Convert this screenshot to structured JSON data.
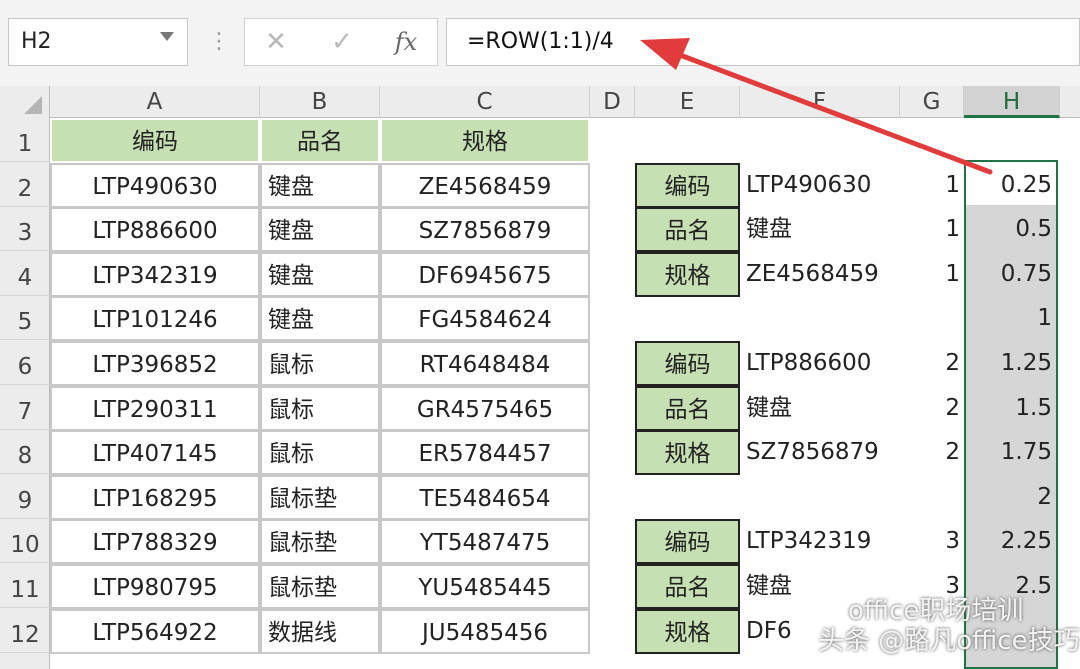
{
  "formula_bar": {
    "name_box": "H2",
    "cancel_icon": "✕",
    "enter_icon": "✓",
    "fx_label": "fx",
    "formula": "=ROW(1:1)/4"
  },
  "columns": [
    "A",
    "B",
    "C",
    "D",
    "E",
    "F",
    "G",
    "H"
  ],
  "selected_column": "H",
  "rows": [
    "1",
    "2",
    "3",
    "4",
    "5",
    "6",
    "7",
    "8",
    "9",
    "10",
    "11",
    "12"
  ],
  "table_headers": [
    "编码",
    "品名",
    "规格"
  ],
  "table_rows": [
    [
      "LTP490630",
      "键盘",
      "ZE4568459"
    ],
    [
      "LTP886600",
      "键盘",
      "SZ7856879"
    ],
    [
      "LTP342319",
      "键盘",
      "DF6945675"
    ],
    [
      "LTP101246",
      "键盘",
      "FG4584624"
    ],
    [
      "LTP396852",
      "鼠标",
      "RT4648484"
    ],
    [
      "LTP290311",
      "鼠标",
      "GR4575465"
    ],
    [
      "LTP407145",
      "鼠标",
      "ER5784457"
    ],
    [
      "LTP168295",
      "鼠标垫",
      "TE5484654"
    ],
    [
      "LTP788329",
      "鼠标垫",
      "YT5487475"
    ],
    [
      "LTP980795",
      "鼠标垫",
      "YU5485445"
    ],
    [
      "LTP564922",
      "数据线",
      "JU5485456"
    ]
  ],
  "right_block": [
    {
      "label": "编码",
      "value": "LTP490630",
      "g": "1"
    },
    {
      "label": "品名",
      "value": "键盘",
      "g": "1"
    },
    {
      "label": "规格",
      "value": "ZE4568459",
      "g": "1"
    },
    {
      "label": "",
      "value": "",
      "g": ""
    },
    {
      "label": "编码",
      "value": "LTP886600",
      "g": "2"
    },
    {
      "label": "品名",
      "value": "键盘",
      "g": "2"
    },
    {
      "label": "规格",
      "value": "SZ7856879",
      "g": "2"
    },
    {
      "label": "",
      "value": "",
      "g": ""
    },
    {
      "label": "编码",
      "value": "LTP342319",
      "g": "3"
    },
    {
      "label": "品名",
      "value": "键盘",
      "g": "3"
    },
    {
      "label": "规格",
      "value": "DF6",
      "g": ""
    }
  ],
  "h_values": [
    "0.25",
    "0.5",
    "0.75",
    "1",
    "1.25",
    "1.5",
    "1.75",
    "2",
    "2.25",
    "2.5",
    ""
  ],
  "watermark": {
    "line1": "office职场培训",
    "line2": "头条 @路凡office技巧"
  },
  "colors": {
    "header_green": "#c6e0b4",
    "selection_green": "#217346",
    "arrow_red": "#e23b3b"
  }
}
